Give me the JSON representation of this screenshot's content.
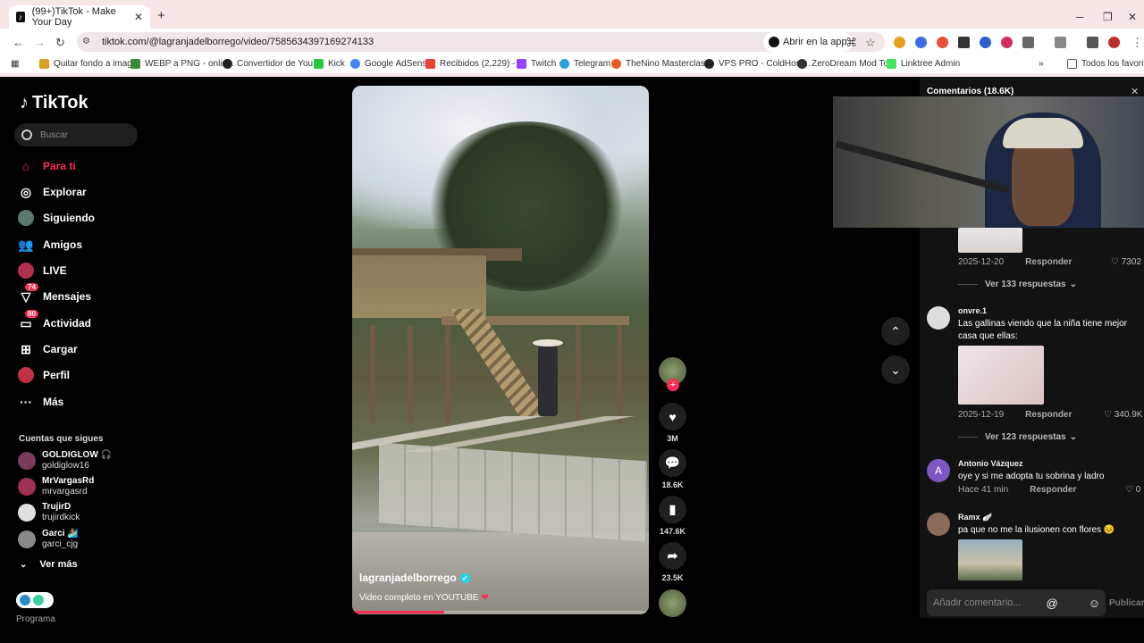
{
  "browser": {
    "tab_title": "(99+)TikTok - Make Your Day",
    "url": "tiktok.com/@lagranjadelborrego/video/7585634397169274133",
    "open_in_app": "Abrir en la app",
    "bookmarks": [
      "Quitar fondo a imag...",
      "WEBP a PNG - onlin...",
      "Convertidor de You...",
      "Kick",
      "Google AdSense",
      "Recibidos (2,229) - f...",
      "Twitch",
      "Telegram",
      "TheNino Masterclas...",
      "VPS PRO - ColdHost...",
      "ZeroDream Mod To...",
      "Linktree Admin"
    ],
    "all_favorites": "Todos los favoritos"
  },
  "sidebar": {
    "logo": "TikTok",
    "search_placeholder": "Buscar",
    "items": [
      {
        "label": "Para ti",
        "badge": ""
      },
      {
        "label": "Explorar",
        "badge": ""
      },
      {
        "label": "Siguiendo",
        "badge": ""
      },
      {
        "label": "Amigos",
        "badge": ""
      },
      {
        "label": "LIVE",
        "badge": ""
      },
      {
        "label": "Mensajes",
        "badge": "74"
      },
      {
        "label": "Actividad",
        "badge": "80"
      },
      {
        "label": "Cargar",
        "badge": ""
      },
      {
        "label": "Perfil",
        "badge": ""
      },
      {
        "label": "Más",
        "badge": ""
      }
    ],
    "following_title": "Cuentas que sigues",
    "following": [
      {
        "name": "GOLDIGLOW 🎧",
        "handle": "goldiglow16"
      },
      {
        "name": "MrVargasRd",
        "handle": "mrvargasrd"
      },
      {
        "name": "TrujirD",
        "handle": "trujirdkick"
      },
      {
        "name": "Garci 🏄",
        "handle": "garci_cjg"
      }
    ],
    "see_more": "Ver más",
    "bottom_text": "Programa"
  },
  "video": {
    "username": "lagranjadelborrego",
    "description": "Video completo en YOUTUBE",
    "progress": 0.31,
    "likes": "3M",
    "comments": "18.6K",
    "saves": "147.6K",
    "shares": "23.5K"
  },
  "comments_panel": {
    "title": "Comentarios (18.6K)",
    "c1": {
      "date": "2025-12-20",
      "reply": "Responder",
      "likes": "7302",
      "view_replies": "Ver 133 respuestas"
    },
    "c2": {
      "user": "onvre.1",
      "text": "Las gallinas viendo que la niña tiene mejor casa que ellas:",
      "date": "2025-12-19",
      "reply": "Responder",
      "likes": "340.9K",
      "view_replies": "Ver 123 respuestas"
    },
    "c3": {
      "avatar_letter": "A",
      "user": "Antonio Vázquez",
      "text": "oye y si me adopta tu sobrina y ladro",
      "date": "Hace 41 min",
      "reply": "Responder",
      "likes": "0"
    },
    "c4": {
      "user": "Ramx 🪽",
      "text": "pa que no me la ilusionen con flores 😣"
    },
    "add_placeholder": "Añadir comentario...",
    "publish": "Publicar"
  }
}
